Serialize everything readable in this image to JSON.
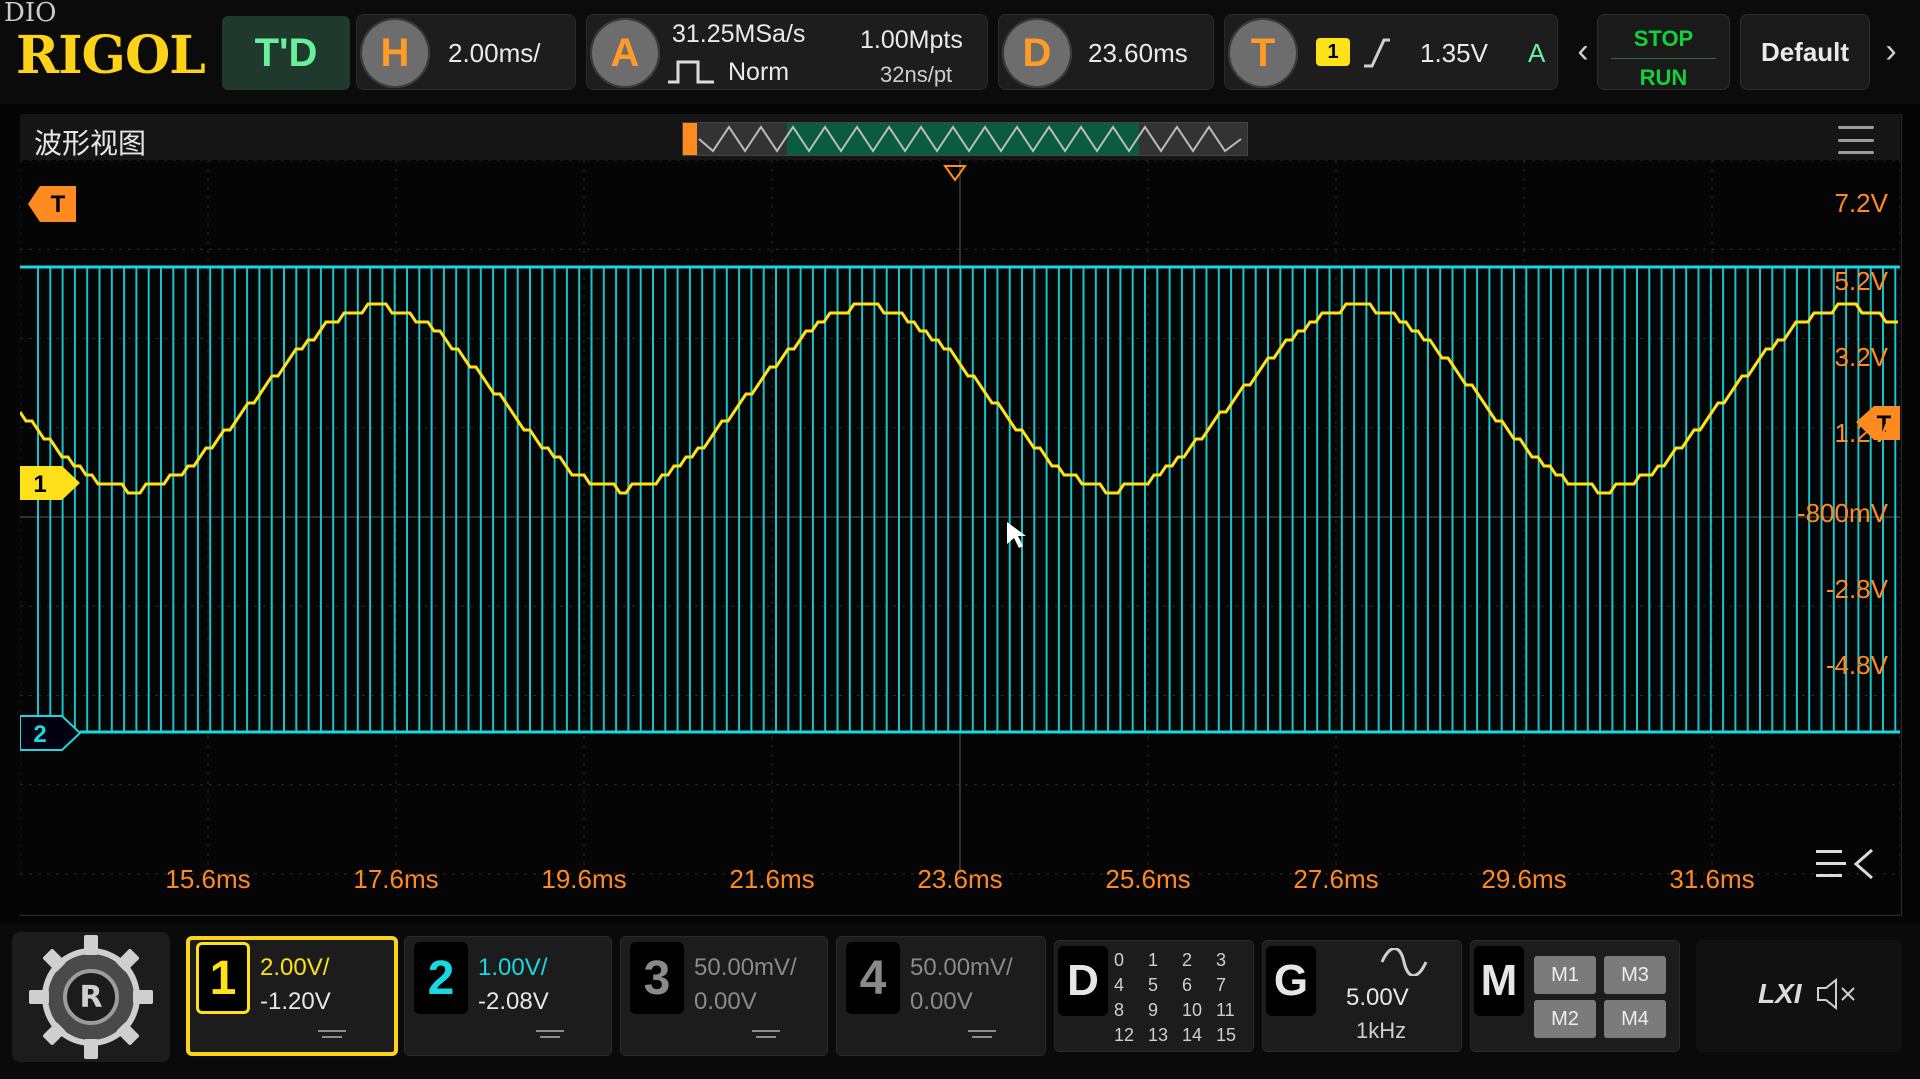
{
  "brand": {
    "corner_text": "DIO",
    "logo": "RIGOL",
    "mode": "T'D"
  },
  "horizontal": {
    "badge": "H",
    "scale": "2.00ms/"
  },
  "acquire": {
    "badge": "A",
    "sample_rate": "31.25MSa/s",
    "mode": "Norm",
    "points": "1.00Mpts",
    "interval": "32ns/pt"
  },
  "delay": {
    "badge": "D",
    "value": "23.60ms"
  },
  "trigger": {
    "badge": "T",
    "source": "1",
    "level": "1.35V",
    "mode": "A"
  },
  "buttons": {
    "stop": "STOP",
    "run": "RUN",
    "default": "Default"
  },
  "window": {
    "title": "波形视图"
  },
  "plot": {
    "y_labels": [
      "7.2V",
      "5.2V",
      "3.2V",
      "1.2V",
      "-800mV",
      "-2.8V",
      "-4.8V"
    ],
    "x_labels": [
      "15.6ms",
      "17.6ms",
      "19.6ms",
      "21.6ms",
      "23.6ms",
      "25.6ms",
      "27.6ms",
      "29.6ms",
      "31.6ms"
    ],
    "markers": {
      "trigger_left": "T",
      "ch1": "1",
      "ch2": "2",
      "trigger_right": "T"
    },
    "colors": {
      "ch1": "#ffe11a",
      "ch2": "#19d8df",
      "accent": "#ff8a1f"
    }
  },
  "channels": [
    {
      "id": "1",
      "scale": "2.00V/",
      "offset": "-1.20V",
      "active": true,
      "color": "#ffe11a"
    },
    {
      "id": "2",
      "scale": "1.00V/",
      "offset": "-2.08V",
      "active": false,
      "color": "#19d8df"
    },
    {
      "id": "3",
      "scale": "50.00mV/",
      "offset": "0.00V",
      "active": false,
      "color": "#8a8a8a"
    },
    {
      "id": "4",
      "scale": "50.00mV/",
      "offset": "0.00V",
      "active": false,
      "color": "#8a8a8a"
    }
  ],
  "digital": {
    "badge": "D",
    "bits": [
      "0",
      "1",
      "2",
      "3",
      "4",
      "5",
      "6",
      "7",
      "8",
      "9",
      "10",
      "11",
      "12",
      "13",
      "14",
      "15"
    ]
  },
  "generator": {
    "badge": "G",
    "amplitude": "5.00V",
    "frequency": "1kHz"
  },
  "math": {
    "badge": "M",
    "items": [
      "M1",
      "M3",
      "M2",
      "M4"
    ]
  },
  "status": {
    "lxi": "LXI"
  }
}
